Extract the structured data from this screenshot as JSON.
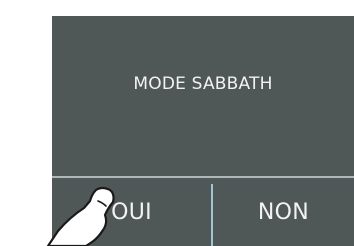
{
  "dialog": {
    "title": "MODE SABBATH",
    "yes_label": "OUI",
    "no_label": "NON"
  },
  "colors": {
    "panel": "#4f5757",
    "text": "#f2f2f2",
    "divider": "#aeb8b8",
    "divider_vertical": "#9fc4d2"
  },
  "overlay": {
    "icon": "pointing-finger-icon"
  }
}
